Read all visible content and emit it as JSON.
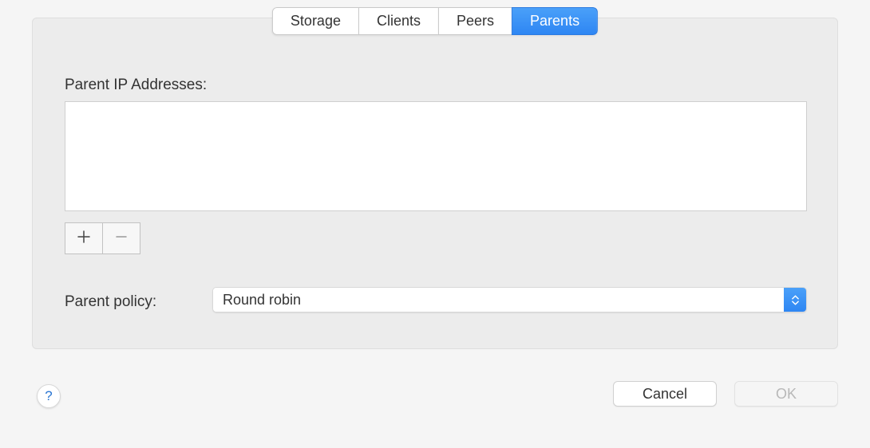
{
  "tabs": {
    "storage": "Storage",
    "clients": "Clients",
    "peers": "Peers",
    "parents": "Parents",
    "active": "parents"
  },
  "labels": {
    "parent_ip": "Parent IP Addresses:",
    "parent_policy": "Parent policy:"
  },
  "ip_list": [],
  "policy": {
    "selected": "Round robin"
  },
  "buttons": {
    "cancel": "Cancel",
    "ok": "OK",
    "help": "?"
  },
  "colors": {
    "accent": "#2e86f3",
    "panel_bg": "#ececec",
    "window_bg": "#f5f5f5"
  }
}
